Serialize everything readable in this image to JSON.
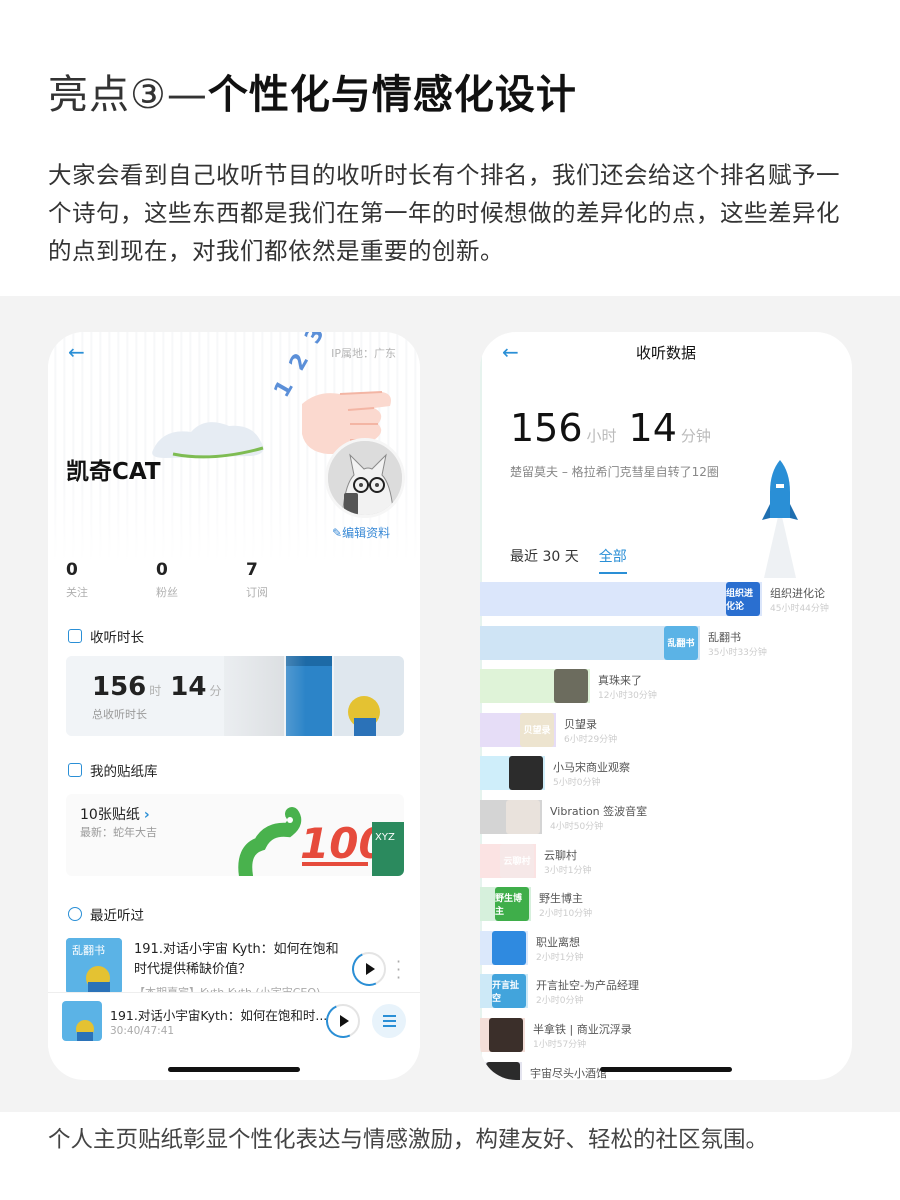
{
  "headline": {
    "light": "亮点③—",
    "bold": "个性化与情感化设计"
  },
  "intro": "大家会看到自己收听节目的收听时长有个排名，我们还会给这个排名赋予一个诗句，这些东西都是我们在第一年的时候想做的差异化的点，这些差异化的点到现在，对我们都依然是重要的创新。",
  "caption": "个人主页贴纸彰显个性化表达与情感激励，构建友好、轻松的社区氛围。",
  "colors": {
    "accent": "#2a8fd6",
    "background_band": "#f3f3f3"
  },
  "left_phone": {
    "back_icon": "←",
    "ip_label": "IP属地：广东",
    "deco_numbers": "1 2 3",
    "user_name": "凯奇CAT",
    "edit_profile": "编辑资料",
    "stats": [
      {
        "value": "0",
        "label": "关注"
      },
      {
        "value": "0",
        "label": "粉丝"
      },
      {
        "value": "7",
        "label": "订阅"
      }
    ],
    "listen_section": {
      "title": "收听时长",
      "hours": "156",
      "hours_unit": "时",
      "minutes": "14",
      "minutes_unit": "分",
      "subtitle": "总收听时长"
    },
    "sticker_section": {
      "title": "我的贴纸库",
      "count_label": "10张贴纸",
      "latest": "最新：蛇年大吉"
    },
    "recent_section": {
      "title": "最近听过",
      "item_title": "191.对话小宇宙 Kyth：如何在饱和时代提供稀缺价值？",
      "item_meta": "【本期嘉宾】Kyth Kyth (小宇宙CEO)"
    },
    "mini_player": {
      "title": "191.对话小宇宙Kyth：如何在饱和时...",
      "time": "30:40/47:41"
    }
  },
  "right_phone": {
    "back_icon": "←",
    "title": "收听数据",
    "hours": "156",
    "hours_unit": "小时",
    "minutes": "14",
    "minutes_unit": "分钟",
    "poem": "楚留莫夫 – 格拉希门克彗星自转了12圈",
    "tabs": [
      {
        "label": "最近 30 天",
        "active": false
      },
      {
        "label": "全部",
        "active": true
      }
    ],
    "ranking": [
      {
        "name": "组织进化论",
        "duration": "45小时44分钟",
        "share": 1.0,
        "bar_color": "#dbe6fb",
        "cover_color": "#2a6fd0",
        "cover_text": "组织进化论"
      },
      {
        "name": "乱翻书",
        "duration": "35小时33分钟",
        "share": 0.78,
        "bar_color": "#cfe4f5",
        "cover_color": "#5bb3e6",
        "cover_text": "乱翻书"
      },
      {
        "name": "真珠来了",
        "duration": "12小时30分钟",
        "share": 0.39,
        "bar_color": "#dff3d8",
        "cover_color": "#6c6c5e",
        "cover_text": ""
      },
      {
        "name": "贝望录",
        "duration": "6小时29分钟",
        "share": 0.27,
        "bar_color": "#e6ddf7",
        "cover_color": "#ede4cf",
        "cover_text": "贝望录"
      },
      {
        "name": "小马宋商业观察",
        "duration": "5小时0分钟",
        "share": 0.23,
        "bar_color": "#cfeefa",
        "cover_color": "#2c2c2c",
        "cover_text": ""
      },
      {
        "name": "Vibration 签波音室",
        "duration": "4小时50分钟",
        "share": 0.22,
        "bar_color": "#d4d4d4",
        "cover_color": "#e9e2dc",
        "cover_text": ""
      },
      {
        "name": "云聊村",
        "duration": "3小时1分钟",
        "share": 0.2,
        "bar_color": "#fbe3e3",
        "cover_color": "#f6e8e8",
        "cover_text": "云聊村"
      },
      {
        "name": "野生博主",
        "duration": "2小时10分钟",
        "share": 0.18,
        "bar_color": "#d6f0dc",
        "cover_color": "#3fae4a",
        "cover_text": "野生博主"
      },
      {
        "name": "职业离想",
        "duration": "2小时1分钟",
        "share": 0.17,
        "bar_color": "#dbe8fb",
        "cover_color": "#2f8ae0",
        "cover_text": ""
      },
      {
        "name": "开言扯空-为产品经理",
        "duration": "2小时0分钟",
        "share": 0.17,
        "bar_color": "#cde9f7",
        "cover_color": "#42a4dc",
        "cover_text": "开言扯空"
      },
      {
        "name": "半拿铁 | 商业沉浮录",
        "duration": "1小时57分钟",
        "share": 0.16,
        "bar_color": "#f3ded8",
        "cover_color": "#3b2f2a",
        "cover_text": ""
      },
      {
        "name": "宇宙尽头小酒馆",
        "duration": "",
        "share": 0.15,
        "bar_color": "#e4e4ef",
        "cover_color": "#2b2b2b",
        "cover_text": ""
      }
    ]
  }
}
